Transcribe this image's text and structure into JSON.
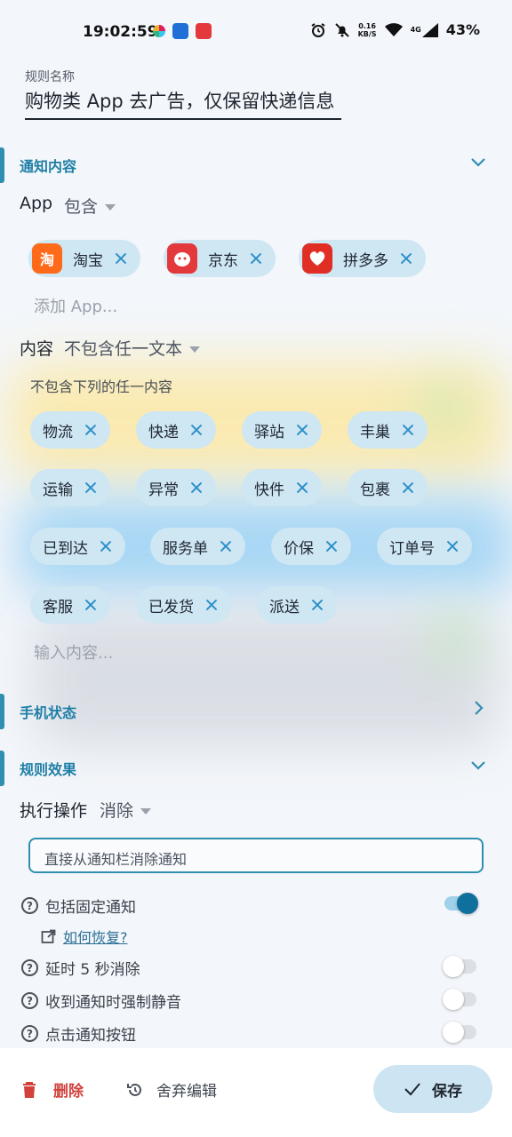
{
  "status_bar": {
    "time": "19:02:59",
    "speed_top": "0.16",
    "speed_bottom": "KB/S",
    "network": "4G",
    "battery": "43%"
  },
  "rule": {
    "name_label": "规则名称",
    "name_value": "购物类 App 去广告，仅保留快递信息"
  },
  "notify_section": {
    "title": "通知内容",
    "app_label": "App",
    "app_mode": "包含",
    "apps": [
      {
        "name": "淘宝",
        "icon": "taobao-icon",
        "color": "#ff6a1a"
      },
      {
        "name": "京东",
        "icon": "jd-icon",
        "color": "#e4393c"
      },
      {
        "name": "拼多多",
        "icon": "pinduoduo-icon",
        "color": "#e02e24"
      }
    ],
    "add_app_placeholder": "添加 App...",
    "content_label": "内容",
    "content_mode": "不包含任一文本",
    "content_hint": "不包含下列的任一内容",
    "keywords": [
      "物流",
      "快递",
      "驿站",
      "丰巢",
      "运输",
      "异常",
      "快件",
      "包裹",
      "已到达",
      "服务单",
      "价保",
      "订单号",
      "客服",
      "已发货",
      "派送"
    ],
    "input_placeholder": "输入内容..."
  },
  "phone_section": {
    "title": "手机状态"
  },
  "effect_section": {
    "title": "规则效果",
    "action_label": "执行操作",
    "action_value": "消除",
    "action_desc": "直接从通知栏消除通知",
    "options": [
      {
        "label": "包括固定通知",
        "on": true
      },
      {
        "label": "延时 5 秒消除",
        "on": false
      },
      {
        "label": "收到通知时强制静音",
        "on": false
      },
      {
        "label": "点击通知按钮",
        "on": false
      }
    ],
    "recover_link": "如何恢复?"
  },
  "bottom_bar": {
    "delete_label": "删除",
    "discard_label": "舍弃编辑",
    "save_label": "保存"
  },
  "colors": {
    "accent": "#2f8fb1",
    "chip_bg": "#cfe6f3",
    "delete": "#d2413c",
    "toggle_on": "#0f6f9d"
  }
}
